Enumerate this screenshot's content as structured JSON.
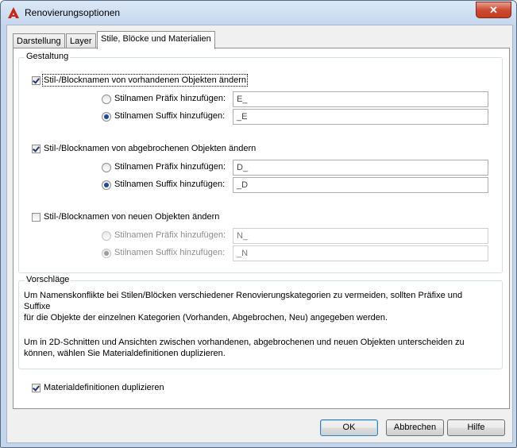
{
  "window": {
    "title": "Renovierungsoptionen",
    "close_glyph": "✕",
    "app_icon": "autocad-red-a-icon"
  },
  "tabs": [
    {
      "label": "Darstellung",
      "active": false
    },
    {
      "label": "Layer",
      "active": false
    },
    {
      "label": "Stile, Blöcke und Materialien",
      "active": true
    }
  ],
  "gestaltung": {
    "title": "Gestaltung",
    "groups": [
      {
        "checkbox_label": "Stil-/Blocknamen von vorhandenen Objekten ändern",
        "checked": true,
        "prefix_label": "Stilnamen Präfix hinzufügen:",
        "prefix_value": "E_",
        "suffix_label": "Stilnamen Suffix hinzufügen:",
        "suffix_value": "_E",
        "selected": "suffix",
        "enabled": true
      },
      {
        "checkbox_label": "Stil-/Blocknamen von abgebrochenen Objekten ändern",
        "checked": true,
        "prefix_label": "Stilnamen Präfix hinzufügen:",
        "prefix_value": "D_",
        "suffix_label": "Stilnamen Suffix hinzufügen:",
        "suffix_value": "_D",
        "selected": "suffix",
        "enabled": true
      },
      {
        "checkbox_label": "Stil-/Blocknamen von neuen Objekten ändern",
        "checked": false,
        "prefix_label": "Stilnamen Präfix hinzufügen:",
        "prefix_value": "N_",
        "suffix_label": "Stilnamen Suffix hinzufügen:",
        "suffix_value": "_N",
        "selected": "suffix",
        "enabled": false
      }
    ]
  },
  "vorschlaege": {
    "title": "Vorschläge",
    "paragraph_1_line_1": "Um Namenskonflikte bei Stilen/Blöcken verschiedener Renovierungskategorien zu vermeiden, sollten Präfixe und Suffixe",
    "paragraph_1_line_2": "für die Objekte der einzelnen Kategorien (Vorhanden, Abgebrochen, Neu) angegeben werden.",
    "paragraph_2_line_1": "Um in 2D-Schnitten und Ansichten zwischen vorhandenen, abgebrochenen und neuen Objekten unterscheiden zu",
    "paragraph_2_line_2": "können, wählen Sie Materialdefinitionen duplizieren."
  },
  "material_checkbox": {
    "label": "Materialdefinitionen duplizieren",
    "checked": true
  },
  "buttons": {
    "ok": "OK",
    "cancel": "Abbrechen",
    "help": "Hilfe"
  }
}
